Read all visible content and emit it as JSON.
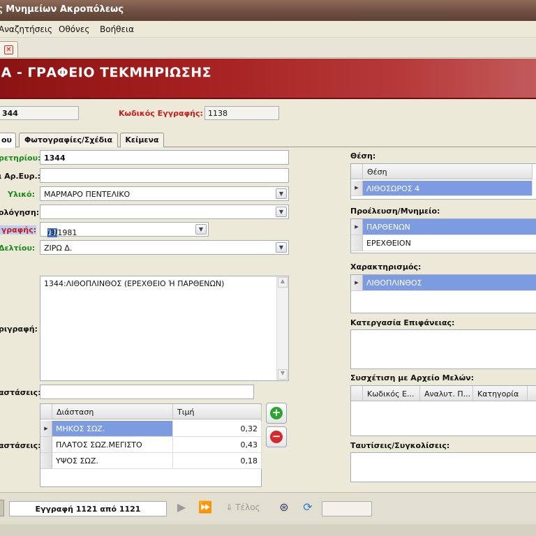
{
  "window": {
    "title": "ς Μνημείων Ακροπόλεως"
  },
  "menu": {
    "items": [
      "Αναζητήσεις",
      "Οθόνες",
      "Βοήθεια"
    ]
  },
  "banner": {
    "title": "ΙΑ - ΓΡΑΦΕΙΟ ΤΕΚΜΗΡΙΩΣΗΣ"
  },
  "header": {
    "left_value": "344",
    "record_code_label": "Κωδικός Εγγραφής:",
    "record_code_value": "1138"
  },
  "tabs": [
    "ου",
    "Φωτογραφίες/Σχέδια",
    "Κείμενα"
  ],
  "form": {
    "registry_label": "ρετηρίου:",
    "registry_value": "1344",
    "other_no_label": "ι Αρ.Ευρ.:",
    "other_no_value": "",
    "material_label": "Υλικό:",
    "material_value": "ΜΑΡΜΑΡΟ ΠΕΝΤΕΛΙΚΟ",
    "dating_label": "ολόγηση:",
    "dating_value": "",
    "reg_date_label": "γραφής:",
    "reg_date_selected": "11",
    "reg_date_rest": "/3/1981",
    "card_author_label": "Δελτίου:",
    "card_author_value": "ΖΙΡΩ Δ.",
    "description_label": "ριγραφή:",
    "description_value": "1344:ΛΙΘΟΠΛΙΝΘΟΣ  (ΕΡΕΧΘΕΙΟ Ή ΠΑΡΘΕΝΩΝ)",
    "dims_text_label": "αστάσεις:",
    "dims_text_value": "",
    "dims_grid_label": "αστάσεις:"
  },
  "dimensions": {
    "columns": [
      "Διάσταση",
      "Τιμή"
    ],
    "rows": [
      {
        "name": "ΜΗΚΟΣ ΣΩΖ.",
        "value": "0,32"
      },
      {
        "name": "ΠΛΑΤΟΣ ΣΩΖ.ΜΕΓΙΣΤΟ",
        "value": "0,43"
      },
      {
        "name": "ΥΨΟΣ ΣΩΖ.",
        "value": "0,18"
      }
    ]
  },
  "right": {
    "position_label": "Θέση:",
    "position_col": "Θέση",
    "position_value": "ΛΙΘΟΣΩΡΟΣ 4",
    "origin_label": "Προέλευση/Μνημείο:",
    "origin_items": [
      "ΠΑΡΘΕΝΩΝ",
      "ΕΡΕΧΘΕΙΟΝ"
    ],
    "character_label": "Χαρακτηρισμός:",
    "character_value": "ΛΙΘΟΠΛΙΝΘΟΣ",
    "surface_label": "Κατεργασία Επιφάνειας:",
    "archive_label": "Συσχέτιση με Αρχείο Μελών:",
    "archive_cols": [
      "Κωδικός Ε...",
      "Αναλυτ. Π...",
      "Κατηγορία"
    ],
    "identify_label": "Ταυτίσεις/Συγκολίσεις:"
  },
  "nav": {
    "record_text": "Εγγραφή 1121 από 1121",
    "end_label": "Τέλος"
  },
  "colors": {
    "banner": "#a51f1f",
    "selection": "#7d9be0",
    "required": "#cc1a1a",
    "optional": "#1a8a1a"
  }
}
